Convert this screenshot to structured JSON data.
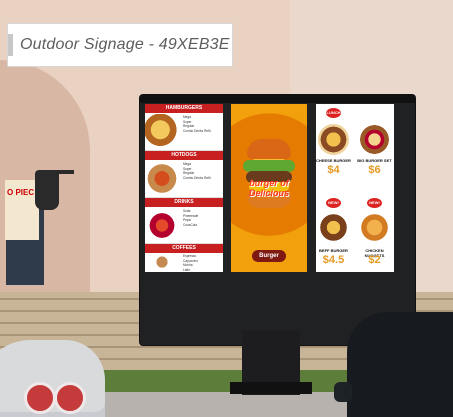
{
  "label": "Outdoor Signage - 49XEB3E",
  "left_screen": {
    "sections": [
      {
        "title": "HAMBURGERS",
        "items": [
          "Mega",
          "Super",
          "Regular",
          "Combo Drinks Refil."
        ]
      },
      {
        "title": "HOTDOGS",
        "items": [
          "Mega",
          "Super",
          "Regular",
          "Combo Drinks Refil."
        ]
      },
      {
        "title": "DRINKS",
        "items": [
          "Soda",
          "Pineeeade",
          "Pepsi",
          "CocaCola"
        ]
      },
      {
        "title": "COFFEES",
        "items": [
          "Espresso",
          "Capuccino",
          "Mocha",
          "Latte"
        ]
      }
    ]
  },
  "center_screen": {
    "title": "burger of Delicious",
    "brand": "Burger"
  },
  "right_screen": {
    "badges": [
      "LUNCH SPECIAL",
      "NEW!",
      "NEW!"
    ],
    "items": [
      {
        "name": "CHEESE BURGER",
        "price": "$4"
      },
      {
        "name": "BIG BURGER SET",
        "price": "$6"
      },
      {
        "name": "BEFF BURGER",
        "price": "$4.5"
      },
      {
        "name": "CHICKEN NUGGETS",
        "price": "$2"
      }
    ]
  },
  "poster_text": "O PIEC",
  "colors": {
    "menu_red": "#c82020",
    "promo_orange": "#f0a000",
    "price_orange": "#e49a24"
  }
}
